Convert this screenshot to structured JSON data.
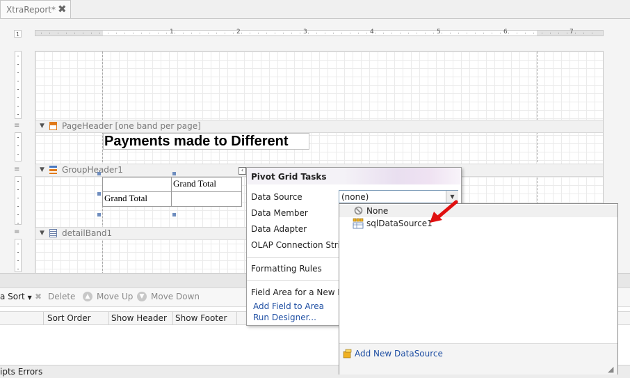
{
  "tabs": [
    {
      "label": "XtraReport*",
      "close": "✖"
    }
  ],
  "ruler": {
    "numbers": [
      "1",
      "2",
      "3",
      "4",
      "5",
      "6",
      "7"
    ],
    "corner": "1"
  },
  "bands": {
    "page_header": "PageHeader [one band per page]",
    "group_header": "GroupHeader1",
    "detail": "detailBand1"
  },
  "report": {
    "title_text": "Payments made to Different"
  },
  "pivot": {
    "col_grand_total": "Grand Total",
    "row_grand_total": "Grand Total"
  },
  "pivot_tasks": {
    "title": "Pivot Grid Tasks",
    "data_source_label": "Data Source",
    "data_source_value": "(none)",
    "data_member_label": "Data Member",
    "data_adapter_label": "Data Adapter",
    "olap_label": "OLAP Connection String",
    "formatting_rules_label": "Formatting Rules",
    "field_area_label": "Field Area for a New Field",
    "add_field_link": "Add Field to Area",
    "run_designer_link": "Run Designer..."
  },
  "dropdown": {
    "items": [
      {
        "label": "None",
        "icon": "none-icon"
      },
      {
        "label": "sqlDataSource1",
        "icon": "datasource-icon"
      }
    ],
    "footer_link": "Add New DataSource"
  },
  "bottom_toolbar": {
    "sort": "a Sort",
    "delete": "Delete",
    "move_up": "Move Up",
    "move_down": "Move Down"
  },
  "grid_columns": [
    "Sort Order",
    "Show Header",
    "Show Footer"
  ],
  "status": {
    "text": "ipts Errors"
  },
  "colors": {
    "accent_link": "#1f4fa3",
    "arrow": "#e01010",
    "handle": "#6e8dbf"
  }
}
